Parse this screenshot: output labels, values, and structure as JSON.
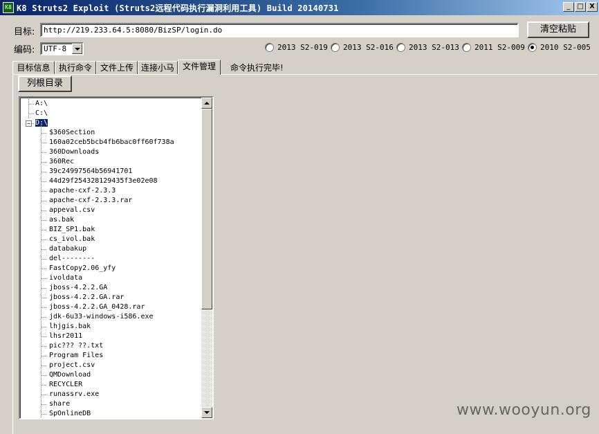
{
  "window": {
    "title": "K8 Struts2 Exploit (Struts2远程代码执行漏洞利用工具) Build 20140731",
    "icon": "K8",
    "minimize": "_",
    "maximize": "□",
    "close": "X"
  },
  "target": {
    "label": "目标:",
    "value": "http://219.233.64.5:8080/BizSP/login.do",
    "clear_button": "清空粘贴"
  },
  "encoding": {
    "label": "编码:",
    "selected": "UTF-8"
  },
  "exploits": [
    {
      "label": "2013 S2-019",
      "selected": false
    },
    {
      "label": "2013 S2-016",
      "selected": false
    },
    {
      "label": "2013 S2-013",
      "selected": false
    },
    {
      "label": "2011 S2-009",
      "selected": false
    },
    {
      "label": "2010 S2-005",
      "selected": true
    }
  ],
  "tabs": [
    {
      "label": "目标信息",
      "active": false
    },
    {
      "label": "执行命令",
      "active": false
    },
    {
      "label": "文件上传",
      "active": false
    },
    {
      "label": "连接小马",
      "active": false
    },
    {
      "label": "文件管理",
      "active": true
    }
  ],
  "status": "命令执行完毕!",
  "file_manager": {
    "list_root_button": "列根目录",
    "drives": [
      "A:\\",
      "C:\\",
      "D:\\"
    ],
    "selected_drive": "D:\\",
    "entries": [
      "$360Section",
      "160a02ceb5bcb4fb6bac0ff60f738a",
      "360Downloads",
      "360Rec",
      "39c24997564b56941701",
      "44d29f254328129435f3e02e08",
      "apache-cxf-2.3.3",
      "apache-cxf-2.3.3.rar",
      "appeval.csv",
      "as.bak",
      "BIZ_SP1.bak",
      "cs_ivol.bak",
      "databakup",
      "del--------",
      "FastCopy2.06_yfy",
      "ivoldata",
      "jboss-4.2.2.GA",
      "jboss-4.2.2.GA.rar",
      "jboss-4.2.2.GA_0428.rar",
      "jdk-6u33-windows-i586.exe",
      "lhjgis.bak",
      "lhsr2011",
      "pic??? ??.txt",
      "Program Files",
      "project.csv",
      "QMDownload",
      "RECYCLER",
      "runassrv.exe",
      "share",
      "SpOnlineDB"
    ]
  },
  "watermark": "www.wooyun.org",
  "colors": {
    "face": "#d4d0c8",
    "titlebar": "#0a246a",
    "selection": "#0a246a"
  }
}
